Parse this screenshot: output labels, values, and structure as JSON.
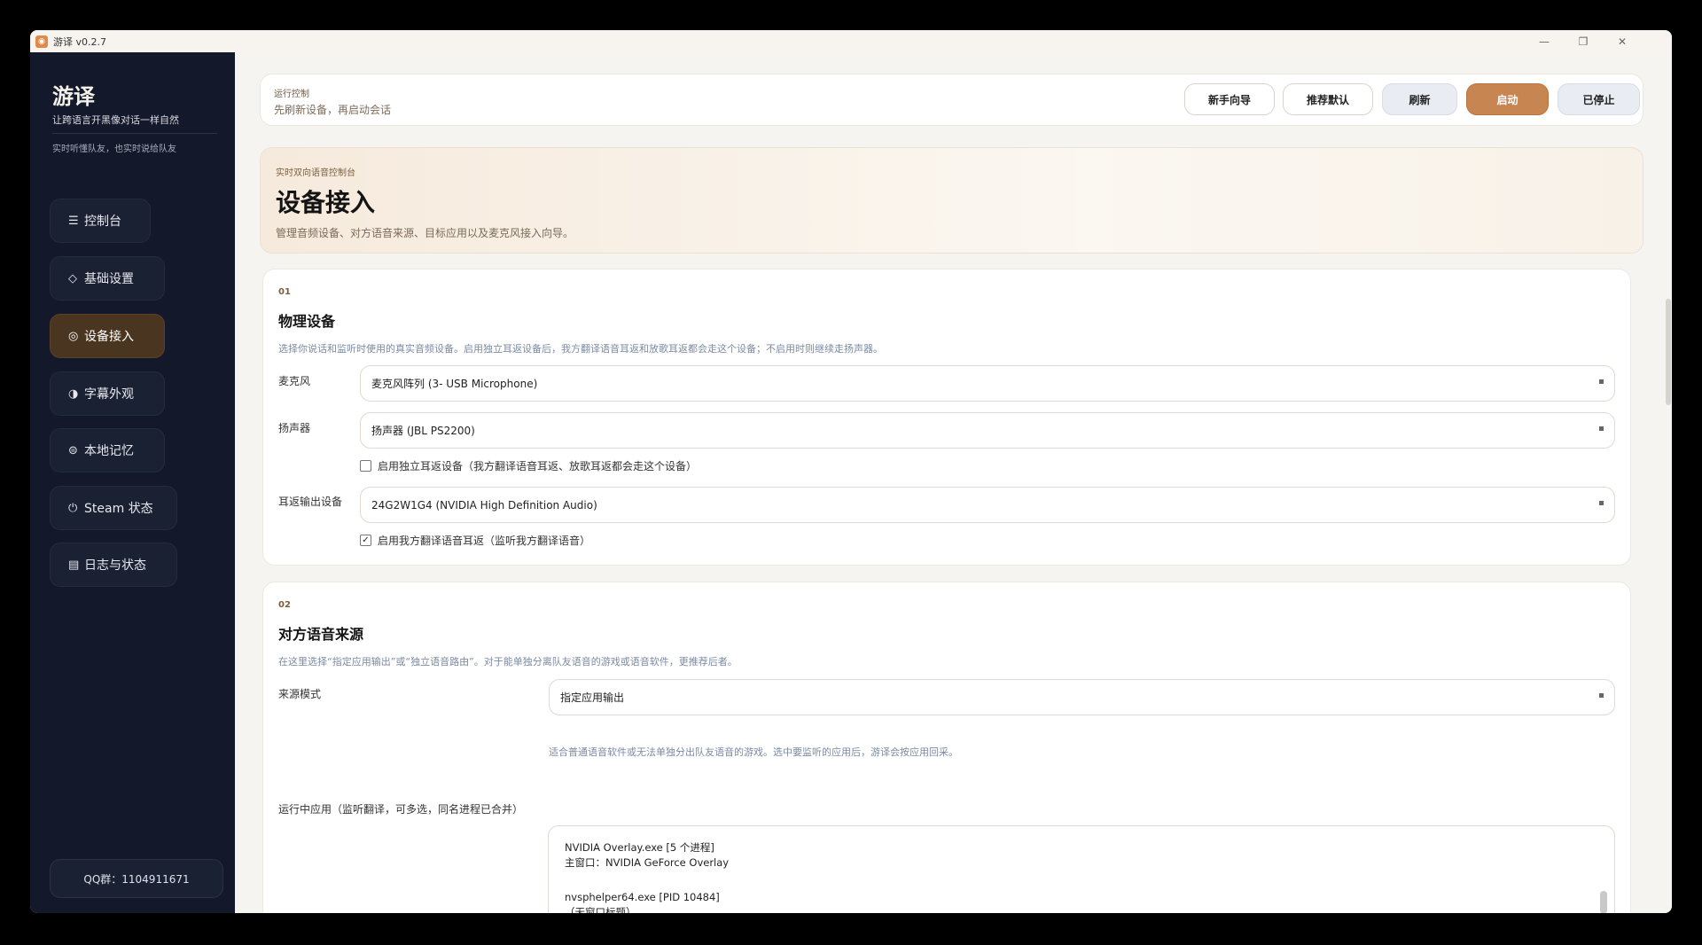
{
  "window": {
    "title": "游译 v0.2.7"
  },
  "sidebar": {
    "brand": "游译",
    "tagline": "让跨语言开黑像对话一样自然",
    "subtag": "实时听懂队友，也实时说给队友",
    "items": [
      {
        "label": "控制台",
        "icon": "console-icon",
        "glyph": "☰"
      },
      {
        "label": "基础设置",
        "icon": "settings-diamond-icon",
        "glyph": "◇"
      },
      {
        "label": "设备接入",
        "icon": "device-icon",
        "glyph": "◎",
        "active": true
      },
      {
        "label": "字幕外观",
        "icon": "subtitle-icon",
        "glyph": "◑"
      },
      {
        "label": "本地记忆",
        "icon": "memory-icon",
        "glyph": "⊜"
      },
      {
        "label": "Steam 状态",
        "icon": "steam-icon",
        "glyph": "⏻"
      },
      {
        "label": "日志与状态",
        "icon": "log-icon",
        "glyph": "▤"
      }
    ],
    "qq": "QQ群：1104911671"
  },
  "topbar": {
    "label": "运行控制",
    "subtitle": "先刷新设备，再启动会话",
    "buttons": {
      "guide": "新手向导",
      "recommend": "推荐默认",
      "refresh": "刷新",
      "start": "启动",
      "stopped": "已停止"
    }
  },
  "hero": {
    "kicker": "实时双向语音控制台",
    "title": "设备接入",
    "desc": "管理音频设备、对方语音来源、目标应用以及麦克风接入向导。"
  },
  "section1": {
    "num": "01",
    "title": "物理设备",
    "desc": "选择你说话和监听时使用的真实音频设备。启用独立耳返设备后，我方翻译语音耳返和放歌耳返都会走这个设备；不启用时则继续走扬声器。",
    "mic_label": "麦克风",
    "mic_value": "麦克风阵列 (3- USB Microphone)",
    "speaker_label": "扬声器",
    "speaker_value": "扬声器 (JBL PS2200)",
    "independent_monitor": "启用独立耳返设备（我方翻译语音耳返、放歌耳返都会走这个设备）",
    "independent_checked": false,
    "monitor_label": "耳返输出设备",
    "monitor_value": "24G2W1G4 (NVIDIA High Definition Audio)",
    "self_monitor": "启用我方翻译语音耳返（监听我方翻译语音）",
    "self_monitor_checked": true
  },
  "section2": {
    "num": "02",
    "title": "对方语音来源",
    "desc": "在这里选择“指定应用输出”或“独立语音路由”。对于能单独分离队友语音的游戏或语音软件，更推荐后者。",
    "mode_label": "来源模式",
    "mode_value": "指定应用输出",
    "hint": "适合普通语音软件或无法单独分出队友语音的游戏。选中要监听的应用后，游译会按应用回采。",
    "apps_label": "运行中应用（监听翻译，可多选，同名进程已合并）",
    "apps": [
      {
        "line1": "NVIDIA Overlay.exe  [5 个进程]",
        "line2": "主窗口：NVIDIA GeForce Overlay"
      },
      {
        "line1": "nvsphelper64.exe  [PID 10484]",
        "line2": "（无窗口标题）"
      }
    ]
  },
  "colors": {
    "sidebar_bg": "#13192a",
    "accent": "#c78552",
    "active_nav": "#4a3520"
  }
}
